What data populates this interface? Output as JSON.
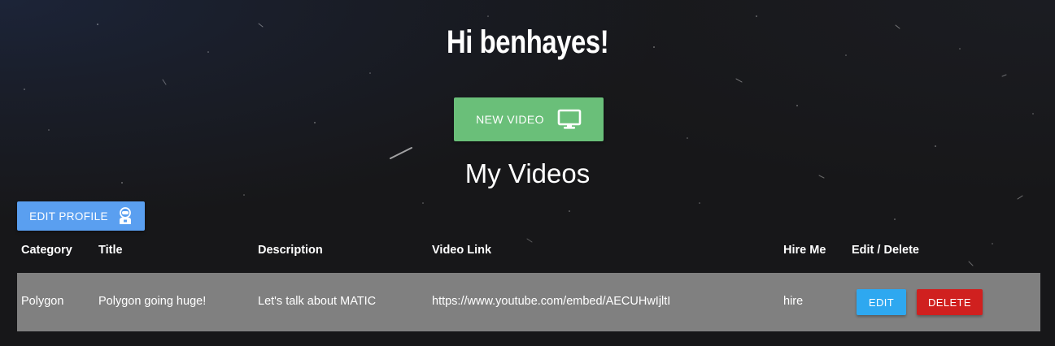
{
  "header": {
    "greeting": "Hi benhayes!"
  },
  "new_video_button": {
    "label": "NEW VIDEO",
    "icon": "monitor-icon",
    "color": "#6abf79"
  },
  "section": {
    "title": "My Videos"
  },
  "edit_profile_button": {
    "label": "EDIT PROFILE",
    "icon": "astronaut-icon",
    "color": "#5a9ff0"
  },
  "table": {
    "columns": [
      "Category",
      "Title",
      "Description",
      "Video Link",
      "Hire Me",
      "Edit / Delete"
    ],
    "rows": [
      {
        "category": "Polygon",
        "title": "Polygon going huge!",
        "description": "Let's talk about MATIC",
        "video_link": "https://www.youtube.com/embed/AECUHwIjltI",
        "hire_me": "hire",
        "edit_label": "EDIT",
        "delete_label": "DELETE"
      }
    ],
    "row_background": "#808080",
    "edit_color": "#2ea8f0",
    "delete_color": "#d0201f"
  }
}
